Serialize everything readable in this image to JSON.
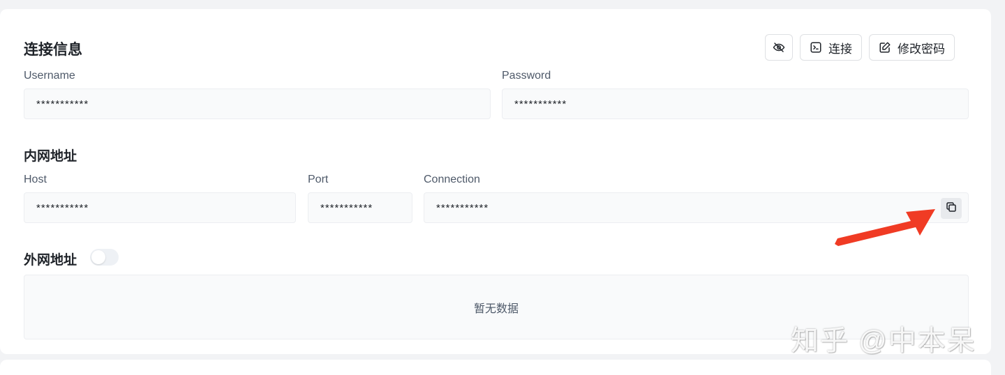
{
  "card": {
    "title": "连接信息",
    "toolbar": {
      "toggle_visibility_icon": "eye-off-icon",
      "connect_icon": "terminal-icon",
      "connect_label": "连接",
      "change_password_icon": "edit-icon",
      "change_password_label": "修改密码"
    },
    "username": {
      "label": "Username",
      "value": "***********"
    },
    "password": {
      "label": "Password",
      "value": "***********"
    },
    "internal": {
      "title": "内网地址",
      "host": {
        "label": "Host",
        "value": "***********"
      },
      "port": {
        "label": "Port",
        "value": "***********"
      },
      "connection": {
        "label": "Connection",
        "value": "***********",
        "copy_icon": "copy-icon"
      }
    },
    "external": {
      "title": "外网地址",
      "toggle_on": false,
      "empty_text": "暂无数据"
    }
  },
  "annotation": {
    "arrow_color": "#f03b24"
  },
  "watermark": "知乎 @中本呆"
}
